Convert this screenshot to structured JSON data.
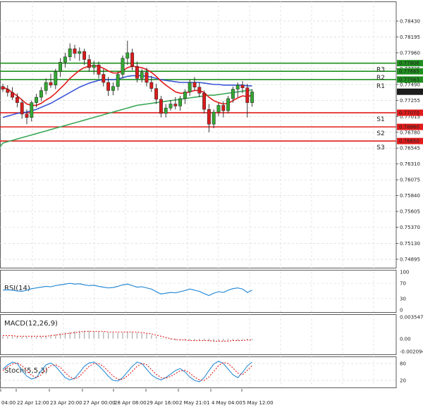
{
  "colors": {
    "background": "#ffffff",
    "grid": "#d9d9d9",
    "bull": "#33a833",
    "bear": "#d81c1c",
    "ma_fast": "#e41a1a",
    "ma_mid": "#3b57d6",
    "ma_slow": "#3aa856",
    "resistance": "#1f8f1f",
    "support": "#e21b1b",
    "indicator": "#2c8dd6",
    "signal": "#e21b1b"
  },
  "chart_data": [
    {
      "type": "candlestick",
      "panel": "price",
      "y_ticks": [
        "0.78430",
        "0.78195",
        "0.77960",
        "0.77725",
        "0.77490",
        "0.77255",
        "0.77015",
        "0.76780",
        "0.76545",
        "0.76310",
        "0.76075",
        "0.75840",
        "0.75605",
        "0.75370",
        "0.75130",
        "0.74895"
      ],
      "ylim": [
        0.74895,
        0.7843
      ],
      "x_labels": [
        "04:00",
        "22 Apr 12:00",
        "23 Apr 20:00",
        "27 Apr 00:00",
        "28 Apr 08:00",
        "29 Apr 16:00",
        "2 May 21:01",
        "4 May 04:00",
        "5 May 12:00"
      ],
      "levels": [
        {
          "name": "R3",
          "value": 0.77806,
          "label": "0.77806",
          "kind": "resistance"
        },
        {
          "name": "R2",
          "value": 0.77685,
          "label": "0.77685",
          "kind": "resistance"
        },
        {
          "name": "R1",
          "value": 0.77563,
          "label": "0.77563",
          "kind": "resistance"
        },
        {
          "name": "S1",
          "value": 0.7707,
          "label": "0.77070",
          "kind": "support"
        },
        {
          "name": "S2",
          "value": 0.7686,
          "label": "0.76860",
          "kind": "support"
        },
        {
          "name": "S3",
          "value": 0.7665,
          "label": "0.76650",
          "kind": "support"
        }
      ],
      "current_price": {
        "value": 0.77382,
        "label": "0.77382"
      },
      "candles": [
        {
          "o": 0.7746,
          "h": 0.775,
          "l": 0.7738,
          "c": 0.7742
        },
        {
          "o": 0.7742,
          "h": 0.7748,
          "l": 0.7731,
          "c": 0.7737
        },
        {
          "o": 0.7737,
          "h": 0.7745,
          "l": 0.7726,
          "c": 0.773
        },
        {
          "o": 0.773,
          "h": 0.7736,
          "l": 0.7715,
          "c": 0.7722
        },
        {
          "o": 0.7722,
          "h": 0.7727,
          "l": 0.7698,
          "c": 0.7705
        },
        {
          "o": 0.7705,
          "h": 0.7712,
          "l": 0.769,
          "c": 0.77
        },
        {
          "o": 0.77,
          "h": 0.7725,
          "l": 0.7694,
          "c": 0.7722
        },
        {
          "o": 0.7722,
          "h": 0.7735,
          "l": 0.7715,
          "c": 0.773
        },
        {
          "o": 0.773,
          "h": 0.7745,
          "l": 0.7724,
          "c": 0.774
        },
        {
          "o": 0.774,
          "h": 0.7758,
          "l": 0.7734,
          "c": 0.7752
        },
        {
          "o": 0.7752,
          "h": 0.7765,
          "l": 0.7744,
          "c": 0.7748
        },
        {
          "o": 0.7748,
          "h": 0.7772,
          "l": 0.7742,
          "c": 0.7768
        },
        {
          "o": 0.7768,
          "h": 0.7788,
          "l": 0.776,
          "c": 0.7782
        },
        {
          "o": 0.7782,
          "h": 0.7796,
          "l": 0.7774,
          "c": 0.779
        },
        {
          "o": 0.779,
          "h": 0.781,
          "l": 0.7784,
          "c": 0.7802
        },
        {
          "o": 0.7802,
          "h": 0.7808,
          "l": 0.7788,
          "c": 0.7795
        },
        {
          "o": 0.7795,
          "h": 0.7804,
          "l": 0.7784,
          "c": 0.7798
        },
        {
          "o": 0.7798,
          "h": 0.7802,
          "l": 0.7778,
          "c": 0.7786
        },
        {
          "o": 0.7786,
          "h": 0.7793,
          "l": 0.7768,
          "c": 0.7774
        },
        {
          "o": 0.7774,
          "h": 0.7784,
          "l": 0.7764,
          "c": 0.7778
        },
        {
          "o": 0.7778,
          "h": 0.7783,
          "l": 0.7758,
          "c": 0.7764
        },
        {
          "o": 0.7764,
          "h": 0.7772,
          "l": 0.7746,
          "c": 0.7752
        },
        {
          "o": 0.7752,
          "h": 0.776,
          "l": 0.7732,
          "c": 0.774
        },
        {
          "o": 0.774,
          "h": 0.7752,
          "l": 0.7733,
          "c": 0.7746
        },
        {
          "o": 0.7746,
          "h": 0.7768,
          "l": 0.774,
          "c": 0.7764
        },
        {
          "o": 0.7764,
          "h": 0.7792,
          "l": 0.7758,
          "c": 0.7788
        },
        {
          "o": 0.7788,
          "h": 0.7814,
          "l": 0.7778,
          "c": 0.7796
        },
        {
          "o": 0.7796,
          "h": 0.7802,
          "l": 0.777,
          "c": 0.7776
        },
        {
          "o": 0.7776,
          "h": 0.7783,
          "l": 0.7752,
          "c": 0.7758
        },
        {
          "o": 0.7758,
          "h": 0.7772,
          "l": 0.7752,
          "c": 0.7767
        },
        {
          "o": 0.7767,
          "h": 0.7774,
          "l": 0.7746,
          "c": 0.7752
        },
        {
          "o": 0.7752,
          "h": 0.7762,
          "l": 0.7738,
          "c": 0.7743
        },
        {
          "o": 0.7743,
          "h": 0.775,
          "l": 0.772,
          "c": 0.7727
        },
        {
          "o": 0.7727,
          "h": 0.7732,
          "l": 0.77,
          "c": 0.7706
        },
        {
          "o": 0.7706,
          "h": 0.772,
          "l": 0.77,
          "c": 0.7714
        },
        {
          "o": 0.7714,
          "h": 0.7726,
          "l": 0.771,
          "c": 0.772
        },
        {
          "o": 0.772,
          "h": 0.773,
          "l": 0.7712,
          "c": 0.7717
        },
        {
          "o": 0.7717,
          "h": 0.7732,
          "l": 0.771,
          "c": 0.7728
        },
        {
          "o": 0.7728,
          "h": 0.7742,
          "l": 0.772,
          "c": 0.7738
        },
        {
          "o": 0.7738,
          "h": 0.7756,
          "l": 0.7732,
          "c": 0.7752
        },
        {
          "o": 0.7752,
          "h": 0.776,
          "l": 0.774,
          "c": 0.7745
        },
        {
          "o": 0.7745,
          "h": 0.7752,
          "l": 0.773,
          "c": 0.7736
        },
        {
          "o": 0.7736,
          "h": 0.774,
          "l": 0.7706,
          "c": 0.7712
        },
        {
          "o": 0.7712,
          "h": 0.772,
          "l": 0.7678,
          "c": 0.769
        },
        {
          "o": 0.769,
          "h": 0.7712,
          "l": 0.7684,
          "c": 0.7708
        },
        {
          "o": 0.7708,
          "h": 0.7722,
          "l": 0.7702,
          "c": 0.7718
        },
        {
          "o": 0.7718,
          "h": 0.7724,
          "l": 0.77,
          "c": 0.771
        },
        {
          "o": 0.771,
          "h": 0.7732,
          "l": 0.7706,
          "c": 0.7728
        },
        {
          "o": 0.7728,
          "h": 0.7746,
          "l": 0.7722,
          "c": 0.7742
        },
        {
          "o": 0.7742,
          "h": 0.7752,
          "l": 0.773,
          "c": 0.7748
        },
        {
          "o": 0.7748,
          "h": 0.7754,
          "l": 0.7736,
          "c": 0.7744
        },
        {
          "o": 0.7744,
          "h": 0.775,
          "l": 0.77,
          "c": 0.7722
        },
        {
          "o": 0.7722,
          "h": 0.7742,
          "l": 0.7716,
          "c": 0.7738
        }
      ],
      "ma_fast": [
        0.7745,
        0.7742,
        0.7737,
        0.7732,
        0.7726,
        0.772,
        0.7718,
        0.7718,
        0.7721,
        0.7726,
        0.773,
        0.7736,
        0.7743,
        0.775,
        0.7758,
        0.7764,
        0.777,
        0.7774,
        0.7776,
        0.7777,
        0.7776,
        0.7773,
        0.7769,
        0.7766,
        0.7766,
        0.7769,
        0.7774,
        0.7776,
        0.7775,
        0.7774,
        0.7771,
        0.7767,
        0.7761,
        0.7754,
        0.7748,
        0.7743,
        0.7738,
        0.7736,
        0.7736,
        0.7738,
        0.774,
        0.774,
        0.7737,
        0.773,
        0.7725,
        0.7722,
        0.772,
        0.7721,
        0.7725,
        0.7729,
        0.7732,
        0.7731,
        0.7733
      ],
      "ma_mid": [
        0.77,
        0.7702,
        0.7704,
        0.7706,
        0.7707,
        0.7708,
        0.771,
        0.7712,
        0.7715,
        0.7718,
        0.7721,
        0.7725,
        0.7729,
        0.7733,
        0.7737,
        0.7741,
        0.7745,
        0.7748,
        0.7751,
        0.7753,
        0.7755,
        0.7756,
        0.7756,
        0.7756,
        0.7757,
        0.7759,
        0.7761,
        0.7762,
        0.7762,
        0.7762,
        0.7761,
        0.776,
        0.7758,
        0.7756,
        0.7755,
        0.7754,
        0.7753,
        0.7752,
        0.7752,
        0.7752,
        0.7752,
        0.7752,
        0.7751,
        0.775,
        0.7749,
        0.7749,
        0.7748,
        0.7748,
        0.7748,
        0.7748,
        0.7748,
        0.7747,
        0.7747
      ],
      "ma_slow": [
        0.7662,
        0.7664,
        0.7666,
        0.7668,
        0.767,
        0.7672,
        0.7674,
        0.7676,
        0.7678,
        0.768,
        0.7682,
        0.7684,
        0.7686,
        0.7688,
        0.769,
        0.7692,
        0.7694,
        0.7696,
        0.7698,
        0.77,
        0.7702,
        0.7704,
        0.7706,
        0.7708,
        0.771,
        0.7712,
        0.7714,
        0.7716,
        0.7718,
        0.7719,
        0.772,
        0.7721,
        0.7722,
        0.7723,
        0.7724,
        0.7725,
        0.7726,
        0.7727,
        0.7728,
        0.7729,
        0.773,
        0.7731,
        0.7732,
        0.7733,
        0.7733,
        0.7734,
        0.7735,
        0.7736,
        0.7737,
        0.7738,
        0.7739,
        0.774,
        0.7741
      ]
    },
    {
      "type": "line",
      "panel": "rsi",
      "label": "RSI(14)",
      "ylim": [
        0,
        100
      ],
      "y_ticks": [
        "100",
        "70",
        "30",
        "0"
      ],
      "values": [
        52,
        53,
        52,
        50,
        49,
        52,
        56,
        58,
        60,
        62,
        61,
        64,
        66,
        68,
        70,
        68,
        69,
        66,
        64,
        65,
        62,
        60,
        58,
        59,
        62,
        66,
        68,
        64,
        60,
        61,
        58,
        55,
        48,
        42,
        44,
        46,
        45,
        48,
        51,
        55,
        52,
        49,
        43,
        38,
        44,
        48,
        46,
        52,
        56,
        58,
        55,
        46,
        52
      ]
    },
    {
      "type": "bar",
      "panel": "macd",
      "label": "MACD(12,26,9)",
      "ylim": [
        -0.002094,
        0.003547
      ],
      "y_ticks": [
        "0.003547",
        "0.00",
        "-0.002094"
      ],
      "values": [
        0.0004,
        0.0004,
        0.0004,
        0.0004,
        0.0003,
        0.0003,
        0.0003,
        0.0003,
        0.0004,
        0.0005,
        0.0006,
        0.0007,
        0.0009,
        0.001,
        0.0011,
        0.0012,
        0.0013,
        0.0013,
        0.0013,
        0.0012,
        0.0012,
        0.0011,
        0.001,
        0.001,
        0.001,
        0.001,
        0.0011,
        0.0011,
        0.001,
        0.0009,
        0.0008,
        0.0006,
        0.0004,
        0.0001,
        -0.0001,
        -0.0002,
        -0.0003,
        -0.0003,
        -0.0003,
        -0.0003,
        -0.0003,
        -0.0003,
        -0.0003,
        -0.0004,
        -0.0004,
        -0.0004,
        -0.0004,
        -0.0003,
        -0.0003,
        -0.0003,
        -0.0002,
        -0.0002,
        -0.0002
      ],
      "signal": [
        0.0005,
        0.0005,
        0.0005,
        0.0004,
        0.0004,
        0.0004,
        0.0004,
        0.0004,
        0.0004,
        0.0004,
        0.0005,
        0.0006,
        0.0007,
        0.0008,
        0.0009,
        0.001,
        0.0011,
        0.0012,
        0.0012,
        0.0012,
        0.0012,
        0.0012,
        0.0011,
        0.0011,
        0.0011,
        0.0011,
        0.0011,
        0.0011,
        0.0011,
        0.001,
        0.0009,
        0.0008,
        0.0006,
        0.0004,
        0.0002,
        0.0,
        -0.0001,
        -0.0002,
        -0.0002,
        -0.0003,
        -0.0003,
        -0.0003,
        -0.0003,
        -0.0003,
        -0.0004,
        -0.0004,
        -0.0004,
        -0.0004,
        -0.0003,
        -0.0003,
        -0.0003,
        -0.0002,
        -0.0002
      ]
    },
    {
      "type": "line",
      "panel": "stoch",
      "label": "Stoch(5,5,3)",
      "ylim": [
        0,
        100
      ],
      "y_ticks": [
        "80",
        "20"
      ],
      "k": [
        60,
        75,
        85,
        80,
        55,
        35,
        25,
        30,
        55,
        75,
        82,
        70,
        50,
        30,
        22,
        28,
        48,
        70,
        82,
        85,
        72,
        55,
        35,
        20,
        18,
        30,
        50,
        70,
        85,
        80,
        60,
        40,
        28,
        22,
        30,
        42,
        55,
        62,
        50,
        32,
        20,
        15,
        30,
        55,
        78,
        88,
        80,
        60,
        40,
        30,
        48,
        72,
        85
      ],
      "d": [
        55,
        68,
        78,
        82,
        72,
        55,
        38,
        30,
        40,
        58,
        72,
        76,
        66,
        48,
        32,
        25,
        34,
        52,
        70,
        80,
        80,
        70,
        52,
        36,
        24,
        24,
        36,
        52,
        70,
        80,
        76,
        58,
        42,
        30,
        28,
        34,
        44,
        54,
        56,
        46,
        32,
        22,
        20,
        32,
        52,
        72,
        84,
        80,
        64,
        46,
        40,
        56,
        72
      ]
    }
  ]
}
